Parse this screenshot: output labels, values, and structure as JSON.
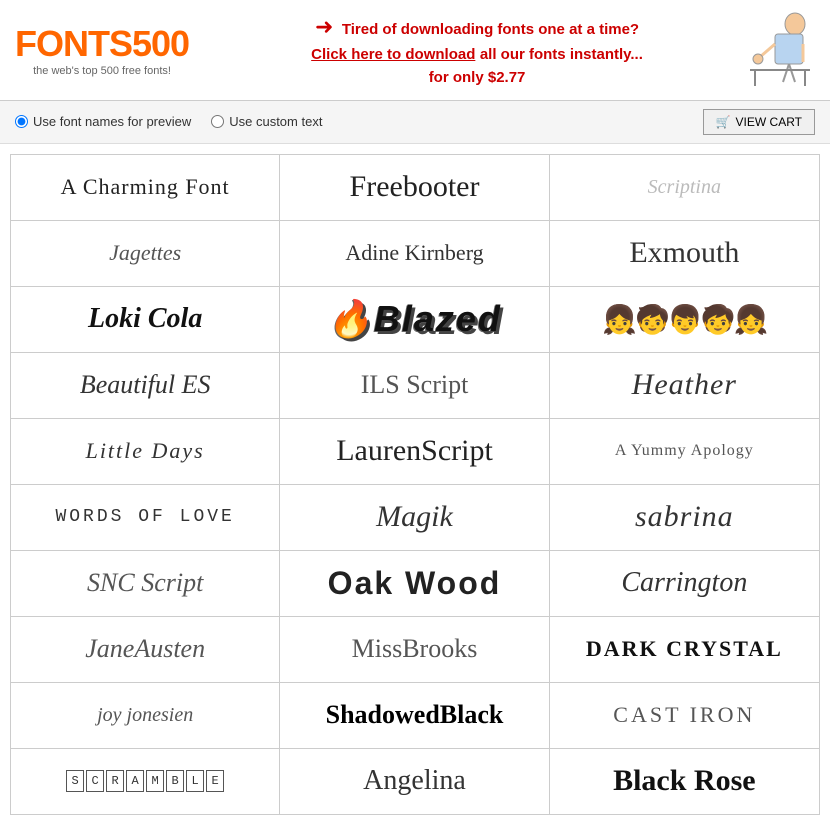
{
  "header": {
    "logo_part1": "FONTS",
    "logo_part2": "500",
    "tagline": "the web's top 500 free fonts!",
    "promo_line1": "Tired of downloading fonts one at a time?",
    "promo_link": "Click here to download",
    "promo_rest": " all our fonts instantly...",
    "promo_line2": "for only $2.77"
  },
  "options": {
    "use_font_names": "Use font names for preview",
    "use_custom_text": "Use custom text",
    "view_cart": "VIEW CART"
  },
  "fonts": [
    [
      "A Charming Font",
      "Freebooter",
      "Scriptina"
    ],
    [
      "Jagettes",
      "Adine Kirnberg",
      "Exmouth"
    ],
    [
      "Loki Cola",
      "Blazed",
      "figures"
    ],
    [
      "Beautiful ES",
      "ILS Script",
      "Heather"
    ],
    [
      "Little Days",
      "LaurenScript",
      "A Yummy Apology"
    ],
    [
      "WORDS OF LOVE",
      "Magik",
      "sabrina"
    ],
    [
      "SNC Script",
      "Oak Wood",
      "Carrington"
    ],
    [
      "JaneAusten",
      "MissBrooks",
      "DarK CrySTal"
    ],
    [
      "joy jonesien",
      "ShadowedBlack",
      "CAST IRON"
    ],
    [
      "SCRAMBLE",
      "Angelina",
      "Black Rose"
    ]
  ]
}
